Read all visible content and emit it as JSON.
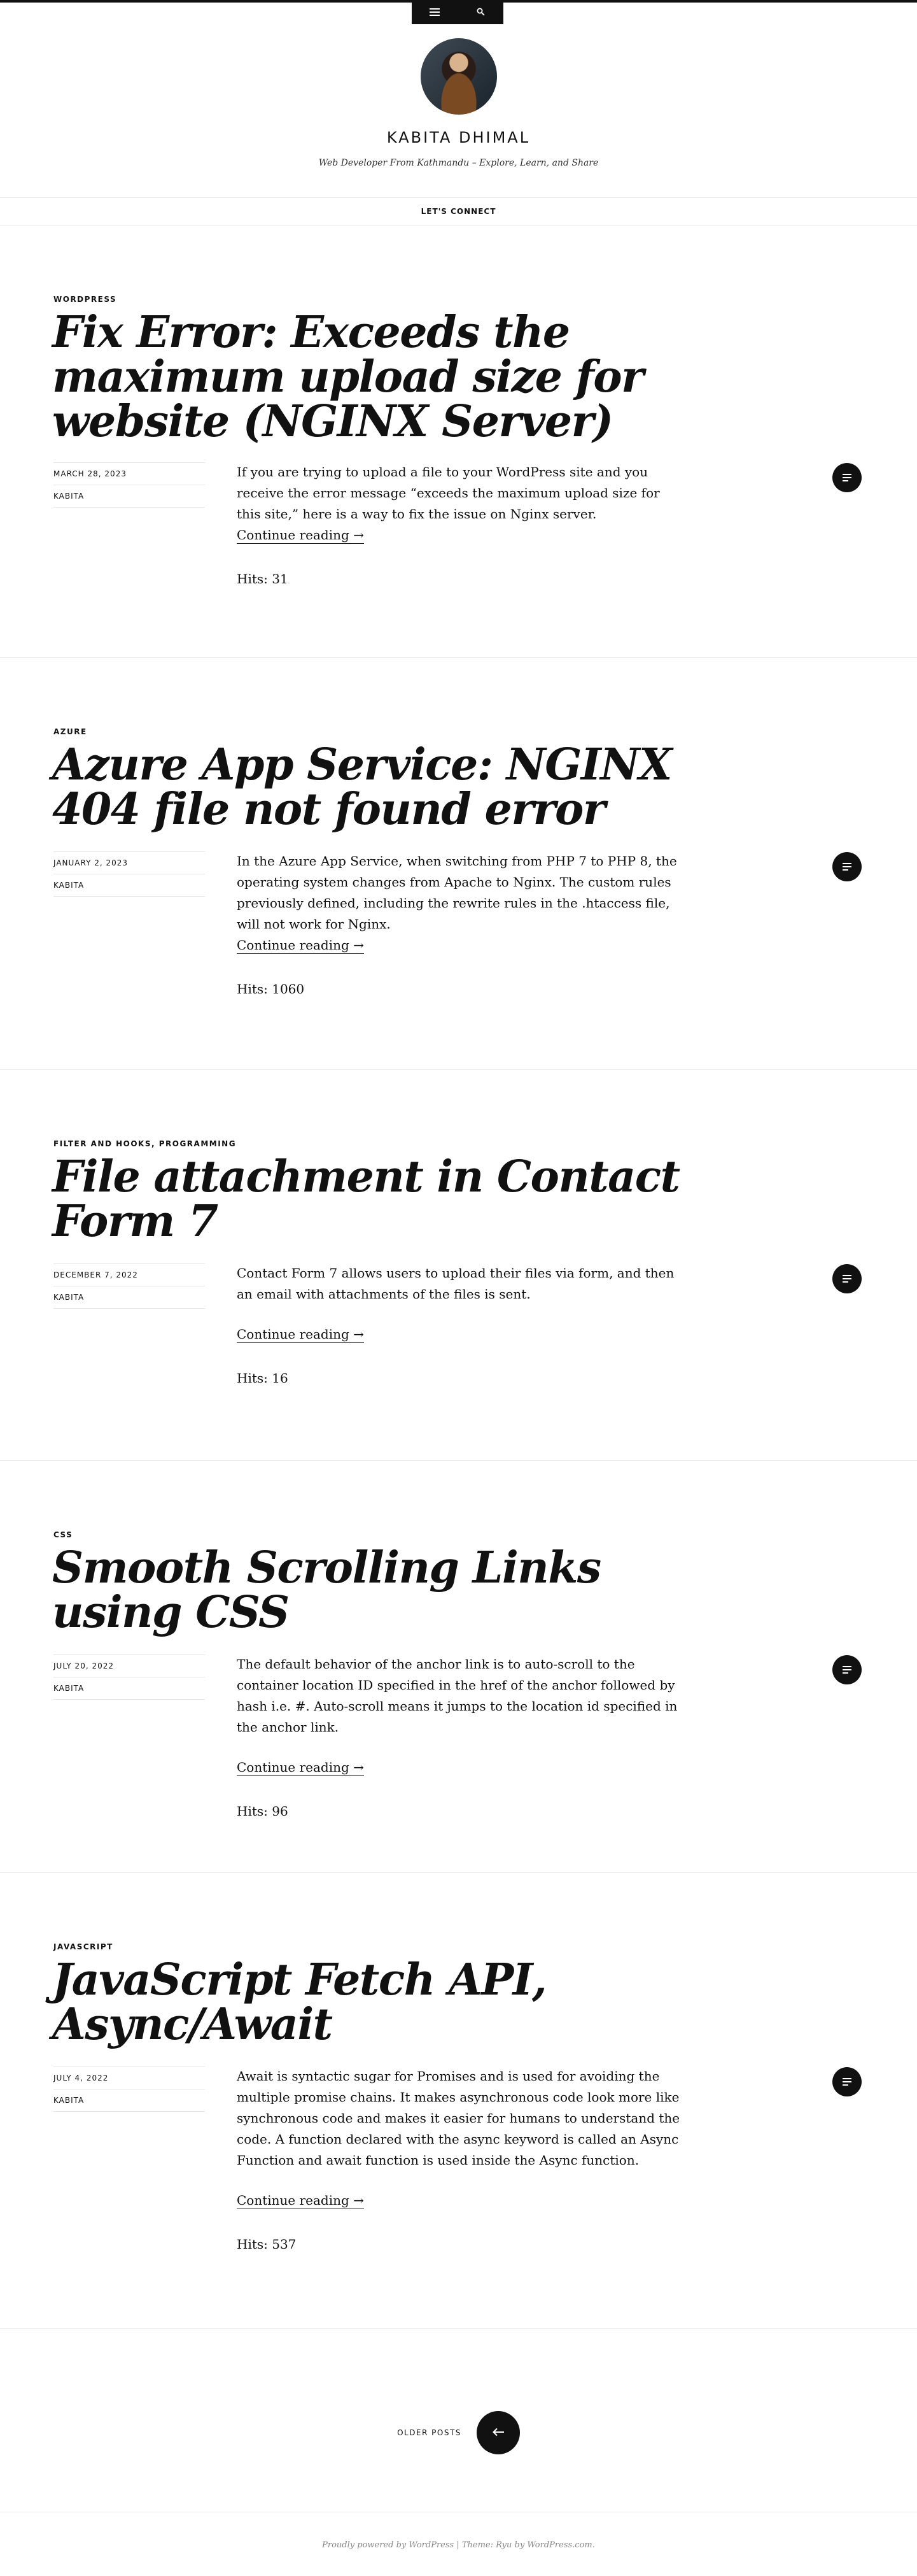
{
  "header": {
    "title": "KABITA DHIMAL",
    "description": "Web Developer From Kathmandu – Explore, Learn, and Share",
    "menu_icon": "menu-icon",
    "search_icon": "search-icon"
  },
  "nav": {
    "link": "LET'S CONNECT"
  },
  "posts": [
    {
      "category": "WORDPRESS",
      "title": "Fix Error: Exceeds the maximum upload size for website (NGINX Server)",
      "date": "MARCH 28, 2023",
      "author": "KABITA",
      "excerpt": "If you are trying to upload a file to your WordPress site and you receive the error message “exceeds the maximum upload size for this site,” here is a way to fix the issue on Nginx server.",
      "more": "Continue reading →",
      "hits": "Hits: 31"
    },
    {
      "category": "AZURE",
      "title": "Azure App Service: NGINX 404 file not found error",
      "date": "JANUARY 2, 2023",
      "author": "KABITA",
      "excerpt": "In the Azure App Service, when switching from PHP 7 to PHP 8, the operating system changes from Apache to Nginx. The custom rules previously defined, including the rewrite rules in the .htaccess file, will not work for Nginx.",
      "more": "Continue reading →",
      "hits": "Hits: 1060"
    },
    {
      "category": "FILTER AND HOOKS, PROGRAMMING",
      "title": "File attachment in Contact Form 7",
      "date": "DECEMBER 7, 2022",
      "author": "KABITA",
      "excerpt": "Contact Form 7 allows users to upload their files via form, and then an email with attachments of the files is sent.",
      "more": "Continue reading →",
      "hits": "Hits: 16"
    },
    {
      "category": "CSS",
      "title": "Smooth Scrolling Links using CSS",
      "date": "JULY 20, 2022",
      "author": "KABITA",
      "excerpt": "The default behavior of the anchor link is to auto-scroll to the container location ID specified in the href of the anchor followed by hash i.e. #. Auto-scroll means it jumps to the location id specified in the anchor link.",
      "more": "Continue reading →",
      "hits": "Hits: 96"
    },
    {
      "category": "JAVASCRIPT",
      "title": "JavaScript Fetch API, Async/Await",
      "date": "JULY 4, 2022",
      "author": "KABITA",
      "excerpt": "Await is syntactic sugar for Promises and is used for avoiding the multiple promise chains. It makes asynchronous code look more like synchronous code and makes it easier for humans to understand the code. A function declared with the async keyword is called an Async Function and await function is used inside the Async function.",
      "more": "Continue reading →",
      "hits": "Hits: 537"
    }
  ],
  "pager": {
    "label": "OLDER POSTS",
    "icon": "arrow-left-icon"
  },
  "footer": {
    "text": "Proudly powered by WordPress | Theme: Ryu by WordPress.com."
  }
}
